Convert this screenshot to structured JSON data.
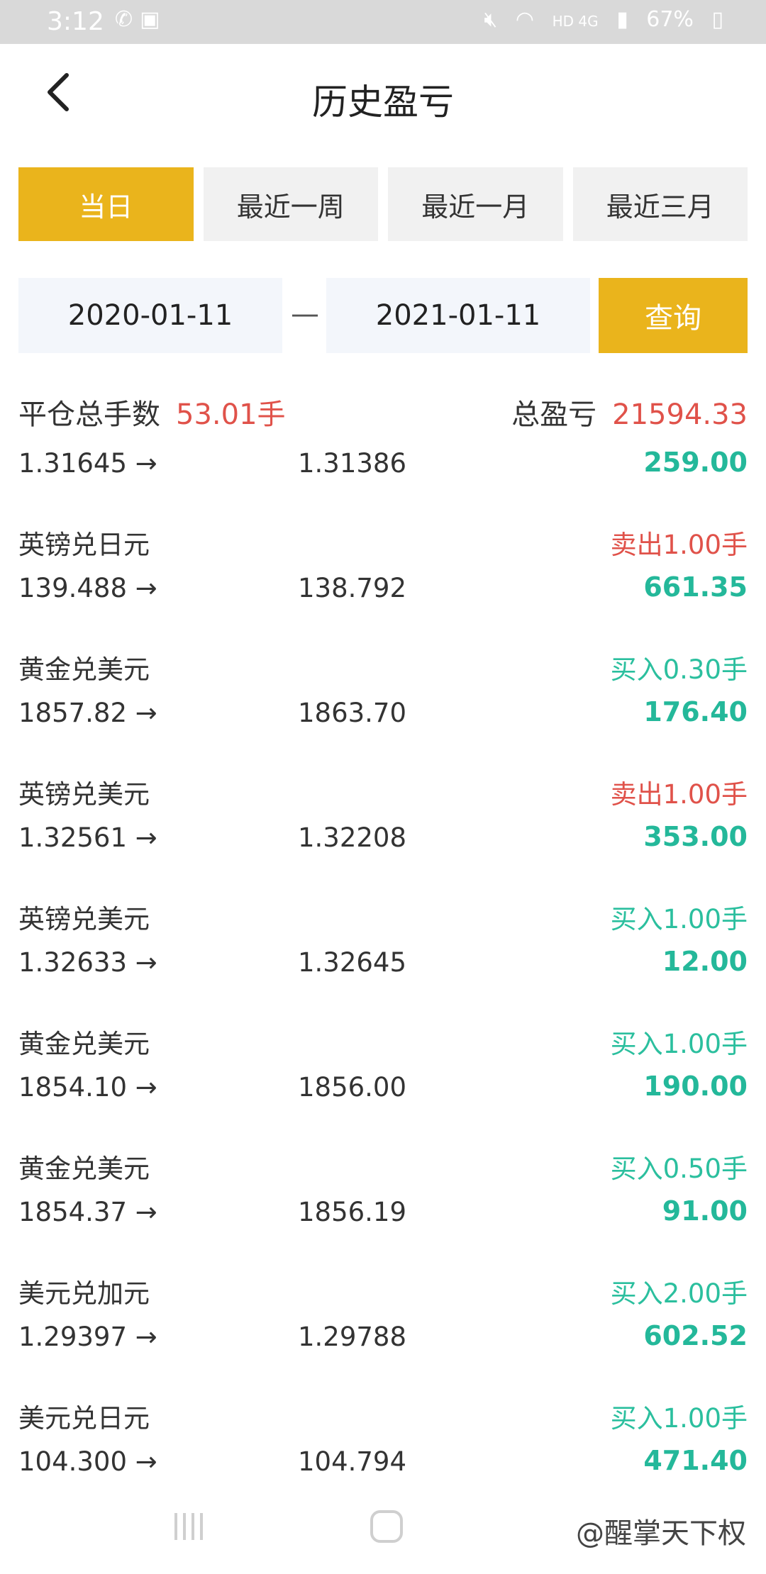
{
  "status_bar": {
    "time": "3:12",
    "battery": "67%",
    "network": "HD 4G",
    "icons": [
      "call-forward-icon",
      "image-icon",
      "mute-icon",
      "wifi-icon",
      "signal-icon",
      "battery-icon"
    ]
  },
  "header": {
    "title": "历史盈亏",
    "back_icon": "chevron-left-icon"
  },
  "tabs": [
    {
      "label": "当日",
      "active": true
    },
    {
      "label": "最近一周",
      "active": false
    },
    {
      "label": "最近一月",
      "active": false
    },
    {
      "label": "最近三月",
      "active": false
    }
  ],
  "range": {
    "from": "2020-01-11",
    "separator": "—",
    "to": "2021-01-11",
    "query_label": "查询"
  },
  "summary": {
    "lots_label": "平仓总手数",
    "lots_value": "53.01手",
    "pnl_label": "总盈亏",
    "pnl_value": "21594.33"
  },
  "trades": [
    {
      "name": "",
      "action": "",
      "side": "",
      "open": "1.31645 →",
      "close": "1.31386",
      "profit": "259.00"
    },
    {
      "name": "英镑兑日元",
      "action": "卖出1.00手",
      "side": "sell",
      "open": "139.488 →",
      "close": "138.792",
      "profit": "661.35"
    },
    {
      "name": "黄金兑美元",
      "action": "买入0.30手",
      "side": "buy",
      "open": "1857.82 →",
      "close": "1863.70",
      "profit": "176.40"
    },
    {
      "name": "英镑兑美元",
      "action": "卖出1.00手",
      "side": "sell",
      "open": "1.32561 →",
      "close": "1.32208",
      "profit": "353.00"
    },
    {
      "name": "英镑兑美元",
      "action": "买入1.00手",
      "side": "buy",
      "open": "1.32633 →",
      "close": "1.32645",
      "profit": "12.00"
    },
    {
      "name": "黄金兑美元",
      "action": "买入1.00手",
      "side": "buy",
      "open": "1854.10 →",
      "close": "1856.00",
      "profit": "190.00"
    },
    {
      "name": "黄金兑美元",
      "action": "买入0.50手",
      "side": "buy",
      "open": "1854.37 →",
      "close": "1856.19",
      "profit": "91.00"
    },
    {
      "name": "美元兑加元",
      "action": "买入2.00手",
      "side": "buy",
      "open": "1.29397 →",
      "close": "1.29788",
      "profit": "602.52"
    },
    {
      "name": "美元兑日元",
      "action": "买入1.00手",
      "side": "buy",
      "open": "104.300 →",
      "close": "104.794",
      "profit": "471.40"
    }
  ],
  "colors": {
    "accent": "#eab41c",
    "sell": "#e0524a",
    "buy": "#2bbf9e",
    "profit": "#24b89a"
  },
  "watermark": "@醒掌天下权"
}
